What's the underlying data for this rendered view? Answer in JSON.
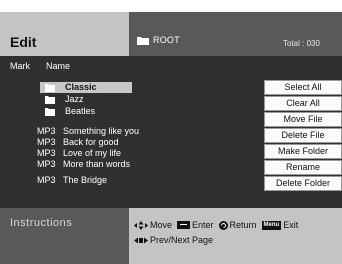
{
  "header": {
    "title": "Edit",
    "folder_icon": "folder-icon",
    "current_folder": "ROOT",
    "total": "Total : 030"
  },
  "list": {
    "columns": {
      "mark": "Mark",
      "name": "Name"
    },
    "folders": [
      {
        "name": "Classic",
        "selected": true
      },
      {
        "name": "Jazz",
        "selected": false
      },
      {
        "name": "Beatles",
        "selected": false
      }
    ],
    "files": [
      {
        "type": "MP3",
        "name": "Something like you"
      },
      {
        "type": "MP3",
        "name": "Back for good"
      },
      {
        "type": "MP3",
        "name": "Love of my life"
      },
      {
        "type": "MP3",
        "name": "More than words"
      },
      {
        "type": "MP3",
        "name": "The Bridge"
      }
    ]
  },
  "actions": {
    "select_all": "Select All",
    "clear_all": "Clear All",
    "move_file": "Move File",
    "delete_file": "Delete File",
    "make_folder": "Make Folder",
    "rename": "Rename",
    "delete_folder": "Delete Folder"
  },
  "instructions": {
    "title": "Instructions",
    "move": "Move",
    "enter": "Enter",
    "return": "Return",
    "menu_badge": "Menu",
    "exit": "Exit",
    "prev_next": "Prev/Next Page"
  },
  "colors": {
    "header_left": "#c4c4c4",
    "header_right": "#595959",
    "list_background": "#303030",
    "selected_row": "#c8c8c8",
    "button_background": "#fafafa"
  }
}
